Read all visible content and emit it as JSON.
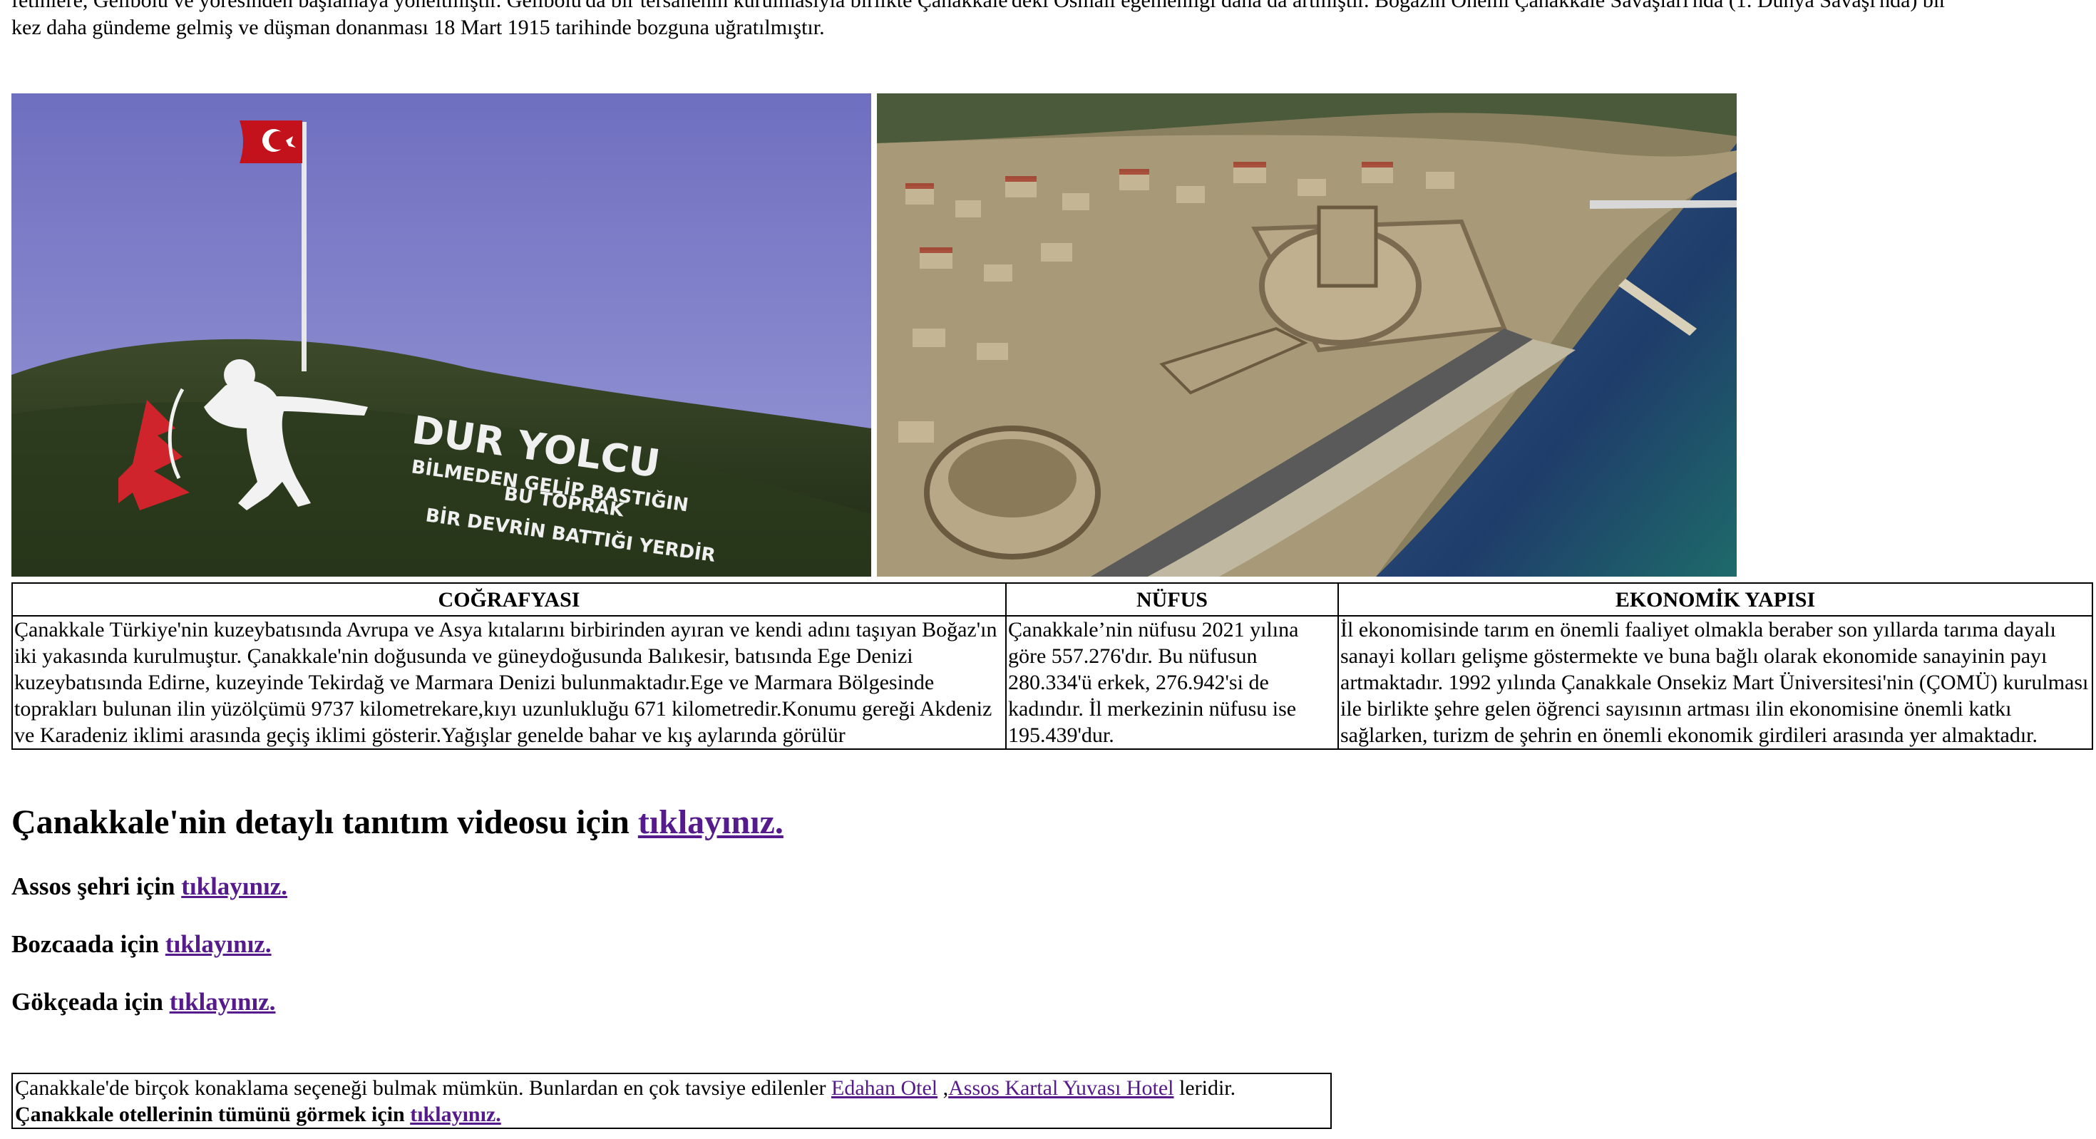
{
  "intro": {
    "line1": "fetihlere, Gelibolu ve yöresinden başlamaya yöneltmiştir. Gelibolu'da bir tersanenin kurulmasıyla birlikte Çanakkale'deki Osmalı egemenliği daha da artmıştır. Boğazın Önemi Çanakkale Savaşları'nda (1. Dünya Savaşı'nda) bir",
    "line2": "kez daha gündeme gelmiş ve düşman donanması 18 Mart 1915 tarihinde bozguna uğratılmıştır."
  },
  "photos": {
    "left": {
      "lines": [
        "DUR YOLCU",
        "BİLMEDEN GELİP BASTIĞIN",
        "BU TOPRAK",
        "BİR DEVRİN BATTIĞI YERDİR"
      ]
    }
  },
  "table": {
    "headers": [
      "COĞRAFYASI",
      "NÜFUS",
      "EKONOMİK YAPISI"
    ],
    "cells": [
      "Çanakkale Türkiye'nin kuzeybatısında Avrupa ve Asya kıtalarını birbirinden ayıran ve kendi adını taşıyan Boğaz'ın iki yakasında kurulmuştur. Çanakkale'nin doğusunda ve güneydoğusunda Balıkesir, batısında Ege Denizi kuzeybatısında Edirne, kuzeyinde Tekirdağ ve Marmara Denizi bulunmaktadır.Ege ve Marmara Bölgesinde toprakları bulunan ilin yüzölçümü 9737 kilometrekare,kıyı uzunlukluğu 671 kilometredir.Konumu gereği Akdeniz ve Karadeniz iklimi arasında geçiş iklimi gösterir.Yağışlar genelde bahar ve kış aylarında görülür",
      "Çanakkale’nin nüfusu 2021 yılına göre 557.276'dır. Bu nüfusun 280.334'ü erkek, 276.942'si de kadındır. İl merkezinin nüfusu ise 195.439'dur.",
      "İl ekonomisinde tarım en önemli faaliyet olmakla beraber son yıllarda tarıma dayalı sanayi kolları gelişme göstermekte ve buna bağlı olarak ekonomide sanayinin payı artmaktadır. 1992 yılında Çanakkale Onsekiz Mart Üniversitesi'nin (ÇOMÜ) kurulması ile birlikte şehre gelen öğrenci sayısının artması ilin ekonomisine önemli katkı sağlarken, turizm de şehrin en önemli ekonomik girdileri arasında yer almaktadır."
    ]
  },
  "links": {
    "video": {
      "text": "Çanakkale'nin detaylı tanıtım videosu için ",
      "link": "tıklayınız."
    },
    "assos": {
      "text": "Assos şehri için ",
      "link": "tıklayınız."
    },
    "bozcaada": {
      "text": "Bozcaada için ",
      "link": "tıklayınız."
    },
    "gokceada": {
      "text": "Gökçeada için ",
      "link": "tıklayınız."
    }
  },
  "hotels": {
    "text": "Çanakkale'de birçok konaklama seçeneği bulmak mümkün. Bunlardan en çok tavsiye edilenler ",
    "hotel1": "Edahan Otel",
    "separator": " ,",
    "hotel2": "Assos Kartal Yuvası Hotel",
    "suffix": " leridir.",
    "all_text": "Çanakkale otellerinin tümünü görmek için ",
    "all_link": "tıklayınız."
  },
  "colors": {
    "link": "#551a8b",
    "border": "#000000"
  }
}
